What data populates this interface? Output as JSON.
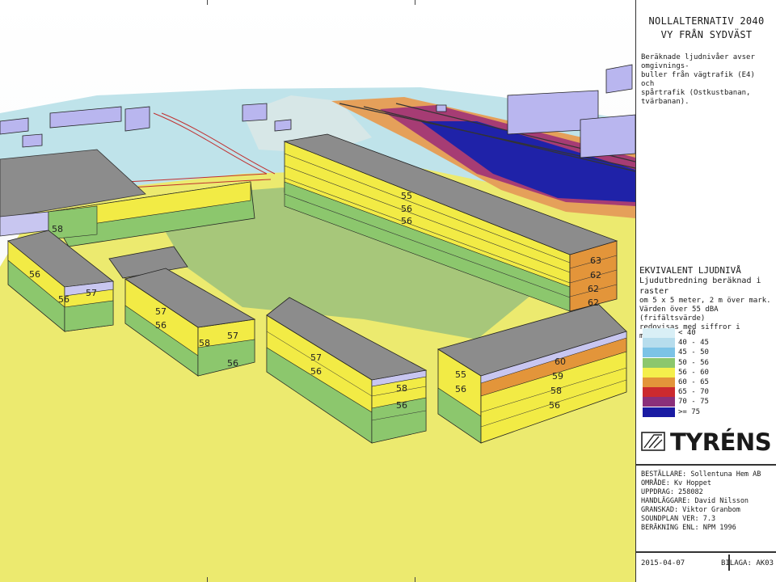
{
  "title": {
    "line1": "NOLLALTERNATIV 2040",
    "line2": "VY FRÅN SYDVÄST"
  },
  "description": {
    "line1": "Beräknade ljudnivåer avser omgivnings-",
    "line2": "buller från vägtrafik (E4) och",
    "line3": "spårtrafik (Ostkustbanan, tvärbanan)."
  },
  "legend": {
    "heading": "EKVIVALENT LJUDNIVÅ",
    "subheading": "Ljudutbredning beräknad i raster",
    "text1": "om 5 x 5 meter, 2 m över mark.",
    "text2": "Värden över 55 dBA (frifältsvärde)",
    "text3": "redovisas med siffror i markör.",
    "classes": [
      {
        "label": "<  40",
        "color": "#d9eff6"
      },
      {
        "label": "40 - 45",
        "color": "#b7dded"
      },
      {
        "label": "45 - 50",
        "color": "#7cc3e6"
      },
      {
        "label": "50 - 56",
        "color": "#8cc76d"
      },
      {
        "label": "56 - 60",
        "color": "#f4ef4c"
      },
      {
        "label": "60 - 65",
        "color": "#e3953a"
      },
      {
        "label": "65 - 70",
        "color": "#cc2a2f"
      },
      {
        "label": "70 - 75",
        "color": "#8b2f7a"
      },
      {
        "label": ">= 75",
        "color": "#1a1ba3"
      }
    ]
  },
  "logo": {
    "text": "TYRÉNS"
  },
  "info": {
    "bestallare": "BESTÄLLARE: Sollentuna Hem AB",
    "omrade": "OMRÅDE: Kv Hoppet",
    "uppdrag": "UPPDRAG: 258082",
    "handlaggare": "HANDLÄGGARE: David Nilsson",
    "granskad": "GRANSKAD: Viktor Granbom",
    "soundplan": "SOUNDPLAN VER: 7.3",
    "berakning": "BERÄKNING ENL: NPM 1996"
  },
  "footer": {
    "date": "2015-04-07",
    "bilaga": "BILAGA: AK03"
  },
  "markers": {
    "back_building": [
      "55",
      "56",
      "56"
    ],
    "orange_corner": [
      "63",
      "62",
      "62",
      "62"
    ],
    "left_far": [
      "56",
      "56",
      "57"
    ],
    "left_far_side": "56",
    "mid_left": [
      "57",
      "56"
    ],
    "mid_left_corner": [
      "58",
      "57",
      "56"
    ],
    "center": [
      "57",
      "56"
    ],
    "center_corner": [
      "58",
      "56"
    ],
    "right": [
      "55",
      "56"
    ],
    "right_corner": [
      "60",
      "59",
      "58",
      "56"
    ],
    "topleft_edge": "58"
  }
}
